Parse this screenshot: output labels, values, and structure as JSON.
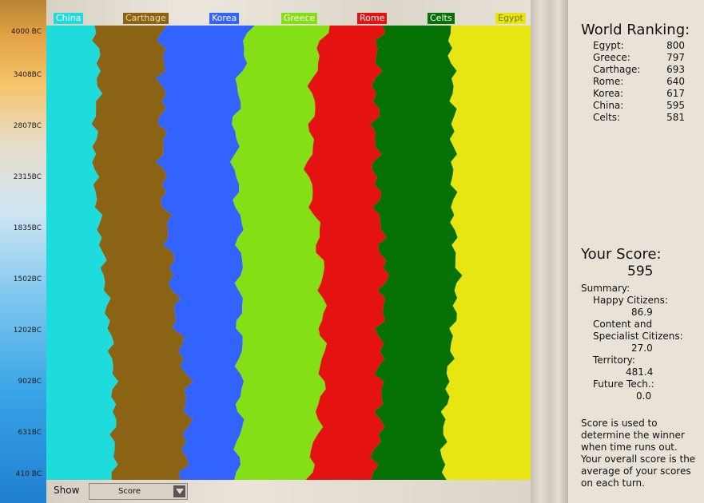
{
  "timeline": {
    "years": [
      "4000 BC",
      "3408BC",
      "2807BC",
      "2315BC",
      "1835BC",
      "1502BC",
      "1202BC",
      "902BC",
      "631BC",
      "410 BC"
    ]
  },
  "legend": [
    {
      "label": "China",
      "color": "#1fdcdc",
      "text": "#ffffff"
    },
    {
      "label": "Carthage",
      "color": "#8b6314",
      "text": "#f1d9a8"
    },
    {
      "label": "Korea",
      "color": "#3363ff",
      "text": "#ffffff"
    },
    {
      "label": "Greece",
      "color": "#84e014",
      "text": "#ffffff"
    },
    {
      "label": "Rome",
      "color": "#e51212",
      "text": "#ffffff"
    },
    {
      "label": "Celts",
      "color": "#067206",
      "text": "#ffffff"
    },
    {
      "label": "Egypt",
      "color": "#e8e612",
      "text": "#7a7700"
    }
  ],
  "chart_data": {
    "type": "area",
    "stacked": true,
    "normalized": true,
    "x": [
      "4000 BC",
      "3408BC",
      "2807BC",
      "2315BC",
      "1835BC",
      "1502BC",
      "1202BC",
      "902BC",
      "631BC",
      "410 BC"
    ],
    "series": [
      {
        "name": "China",
        "color": "#1fdcdc",
        "values": [
          0.1,
          0.11,
          0.1,
          0.1,
          0.11,
          0.12,
          0.13,
          0.14,
          0.14,
          0.14
        ]
      },
      {
        "name": "Carthage",
        "color": "#8b6314",
        "values": [
          0.14,
          0.13,
          0.14,
          0.14,
          0.14,
          0.14,
          0.14,
          0.15,
          0.15,
          0.14
        ]
      },
      {
        "name": "Korea",
        "color": "#3363ff",
        "values": [
          0.18,
          0.16,
          0.15,
          0.15,
          0.15,
          0.14,
          0.13,
          0.11,
          0.11,
          0.11
        ]
      },
      {
        "name": "Greece",
        "color": "#84e014",
        "values": [
          0.16,
          0.15,
          0.16,
          0.15,
          0.16,
          0.17,
          0.17,
          0.17,
          0.16,
          0.15
        ]
      },
      {
        "name": "Rome",
        "color": "#e51212",
        "values": [
          0.11,
          0.13,
          0.13,
          0.14,
          0.13,
          0.13,
          0.12,
          0.12,
          0.13,
          0.13
        ]
      },
      {
        "name": "Celts",
        "color": "#067206",
        "values": [
          0.14,
          0.16,
          0.16,
          0.16,
          0.15,
          0.15,
          0.15,
          0.14,
          0.13,
          0.15
        ]
      },
      {
        "name": "Egypt",
        "color": "#e8e612",
        "values": [
          0.17,
          0.16,
          0.16,
          0.16,
          0.16,
          0.15,
          0.16,
          0.17,
          0.18,
          0.18
        ]
      }
    ]
  },
  "show_control": {
    "label": "Show",
    "selected": "Score"
  },
  "ranking": {
    "title": "World Ranking:",
    "rows": [
      {
        "name": "Egypt:",
        "score": "800"
      },
      {
        "name": "Greece:",
        "score": "797"
      },
      {
        "name": "Carthage:",
        "score": "693"
      },
      {
        "name": "Rome:",
        "score": "640"
      },
      {
        "name": "Korea:",
        "score": "617"
      },
      {
        "name": "China:",
        "score": "595"
      },
      {
        "name": "Celts:",
        "score": "581"
      }
    ]
  },
  "score": {
    "title": "Your Score:",
    "value": "595",
    "summary_label": "Summary:",
    "happy_label": "Happy Citizens:",
    "happy_value": "86.9",
    "content_label_1": "Content and",
    "content_label_2": "Specialist Citizens:",
    "content_value": "27.0",
    "territory_label": "Territory:",
    "territory_value": "481.4",
    "future_label": "Future Tech.:",
    "future_value": "0.0",
    "note_lines": [
      "Score is used to",
      "determine the winner",
      "when time runs out.",
      "Your overall score is the",
      "average of your scores",
      "on each turn."
    ]
  }
}
